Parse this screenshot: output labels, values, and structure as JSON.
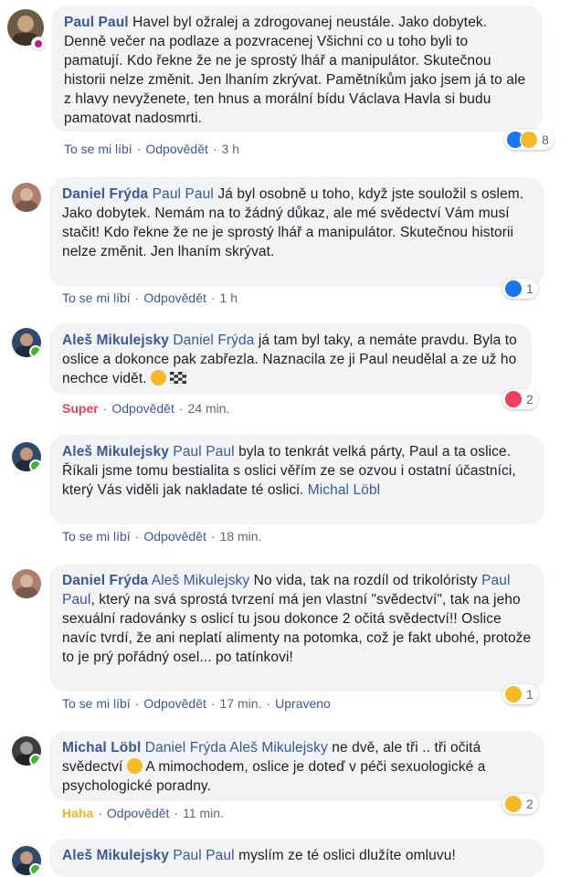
{
  "comments": [
    {
      "author": "Paul Paul",
      "mentions": "",
      "text": "Havel byl ožralej a zdrogovanej neustále. Jako dobytek. Denně večer na podlaze a pozvracenej Všichni co u toho byli to pamatují. Kdo řekne že ne je sprostý lhář a manipulátor. Skutečnou historii nelze změnit. Jen lhaním zkrývat. Pamětníkům jako jsem já to ale z hlavy nevyženete, ten hnus a morální bídu Václava Havla si budu pamatovat nadosmrti.",
      "like": "To se mi líbí",
      "reply": "Odpovědět",
      "time": "3 h",
      "reaction_count": "8"
    },
    {
      "author": "Daniel Frýda",
      "mentions": "Paul Paul",
      "text": "Já byl osobně u toho, když jste souložil s oslem. Jako dobytek. Nemám na to žádný důkaz, ale mé svědectví Vám musí stačit! Kdo řekne že ne je sprostý lhář a manipulátor. Skutečnou historii nelze změnit. Jen lhaním skrývat.",
      "like": "To se mi líbí",
      "reply": "Odpovědět",
      "time": "1 h",
      "reaction_count": "1"
    },
    {
      "author": "Aleš Mikulejsky",
      "mentions": "Daniel Frýda",
      "text": "já tam byl taky, a nemáte pravdu. Byla to oslice a dokonce pak zabřezla. Naznacila ze ji Paul neudělal a ze už ho nechce vidět.",
      "like": "Super",
      "reply": "Odpovědět",
      "time": "24 min.",
      "reaction_count": "2"
    },
    {
      "author": "Aleš Mikulejsky",
      "mentions": "Paul Paul",
      "text": "byla to tenkrát velká párty, Paul a ta oslice. Říkali jsme tomu bestialita s oslici věřím ze se ozvou i ostatní účastníci, který Vás viděli jak nakladate té oslici.",
      "tail_mention": "Michal Löbl",
      "like": "To se mi líbí",
      "reply": "Odpovědět",
      "time": "18 min."
    },
    {
      "author": "Daniel Frýda",
      "mentions": "Aleš Mikulejsky",
      "text_a": "No vida, tak na rozdíl od trikolóristy",
      "inline_mention": "Paul Paul",
      "text_b": ", který na svá sprostá tvrzení má jen vlastní \"svědectví\", tak na jeho sexuální radovánky s oslicí tu jsou dokonce 2 očitá svědectví!! Oslice navíc tvrdí, že ani neplatí alimenty na potomka, což je fakt ubohé, protože to je prý pořádný osel... po tatínkovi!",
      "like": "To se mi líbí",
      "reply": "Odpovědět",
      "time": "17 min.",
      "edited": "Upraveno",
      "reaction_count": "1"
    },
    {
      "author": "Michal Löbl",
      "mentions": "Daniel Frýda Aleš Mikulejsky",
      "text_a": "ne dvě, ale tři .. tři očitá svědectví",
      "text_b": "A mimochodem, oslice je doteď v péči sexuologické a psychologické poradny.",
      "like": "Haha",
      "reply": "Odpovědět",
      "time": "11 min.",
      "reaction_count": "2"
    },
    {
      "author": "Aleš Mikulejsky",
      "mentions": "Paul Paul",
      "text": "myslím ze té oslici dlužíte omluvu!"
    }
  ]
}
